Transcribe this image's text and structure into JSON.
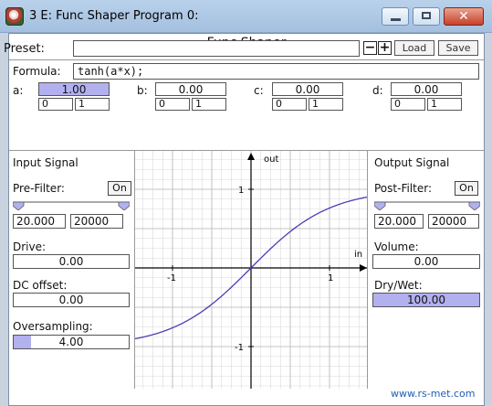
{
  "window": {
    "title": "3 E: Func Shaper Program 0:",
    "close_glyph": "✕"
  },
  "app_title": "Func Shaper",
  "preset": {
    "label": "Preset:",
    "value": "",
    "minus": "−",
    "plus": "+",
    "load": "Load",
    "save": "Save"
  },
  "formula": {
    "label": "Formula:",
    "value": "tanh(a*x);"
  },
  "params": [
    {
      "name": "a:",
      "value": "1.00",
      "fill": 1.0,
      "min": "0",
      "max": "1"
    },
    {
      "name": "b:",
      "value": "0.00",
      "fill": 0.0,
      "min": "0",
      "max": "1"
    },
    {
      "name": "c:",
      "value": "0.00",
      "fill": 0.0,
      "min": "0",
      "max": "1"
    },
    {
      "name": "d:",
      "value": "0.00",
      "fill": 0.0,
      "min": "0",
      "max": "1"
    }
  ],
  "input_signal": {
    "title": "Input Signal",
    "prefilter_label": "Pre-Filter:",
    "prefilter_toggle": "On",
    "freq_low": "20.000",
    "freq_high": "20000",
    "drive_label": "Drive:",
    "drive_value": "0.00",
    "drive_fill": 0.0,
    "dc_label": "DC offset:",
    "dc_value": "0.00",
    "dc_fill": 0.0,
    "oversampling_label": "Oversampling:",
    "oversampling_value": "4.00",
    "oversampling_fill": 0.15
  },
  "output_signal": {
    "title": "Output Signal",
    "postfilter_label": "Post-Filter:",
    "postfilter_toggle": "On",
    "freq_low": "20.000",
    "freq_high": "20000",
    "volume_label": "Volume:",
    "volume_value": "0.00",
    "volume_fill": 0.0,
    "drywet_label": "Dry/Wet:",
    "drywet_value": "100.00",
    "drywet_fill": 1.0
  },
  "plot": {
    "x_axis_label": "in",
    "y_axis_label": "out",
    "x_ticks": [
      "-1",
      "1"
    ],
    "y_ticks": [
      "1",
      "-1"
    ],
    "x_range": [
      -1.5,
      1.5
    ],
    "y_range": [
      -1.5,
      1.5
    ],
    "curve_color": "#4a3fb5",
    "formula": "tanh"
  },
  "footer": {
    "link": "www.rs-met.com"
  },
  "colors": {
    "slider_fill": "#b2b0ef",
    "titlebar": "#b9d1ea",
    "link": "#1f5db8",
    "close": "#c7412a"
  }
}
